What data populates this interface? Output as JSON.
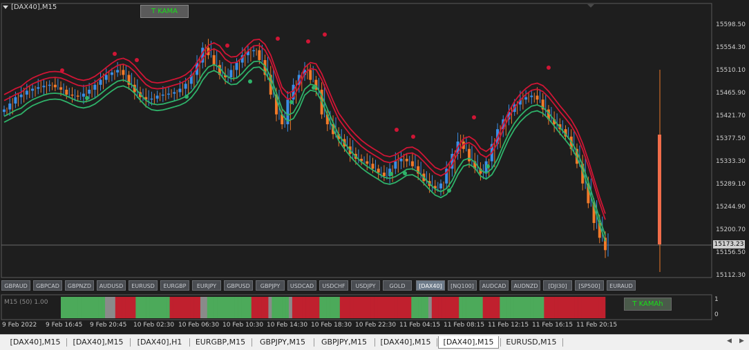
{
  "window": {
    "title": "[DAX40],M15"
  },
  "indicator_button": {
    "label": "T KAMA"
  },
  "indicator_button_2": {
    "label": "T KAMAh"
  },
  "price_axis": [
    "15598.50",
    "15554.30",
    "15510.10",
    "15465.90",
    "15421.70",
    "15377.50",
    "15333.30",
    "15289.10",
    "15244.90",
    "15200.70",
    "15156.50",
    "15112.30"
  ],
  "current_price": "15173.23",
  "subwindow": {
    "label": "M15 (50) 1.00",
    "axis": [
      "1",
      "1",
      "0",
      "0"
    ]
  },
  "symbols": [
    "GBPAUD",
    "GBPCAD",
    "GBPNZD",
    "AUDUSD",
    "EURUSD",
    "EURGBP",
    "EURJPY",
    "GBPUSD",
    "GBPJPY",
    "USDCAD",
    "USDCHF",
    "USDJPY",
    "GOLD",
    "[DAX40]",
    "[NQ100]",
    "AUDCAD",
    "AUDNZD",
    "[DJI30]",
    "[SP500]",
    "EURAUD"
  ],
  "active_symbol": "[DAX40]",
  "time_axis": [
    "9 Feb 2022",
    "9 Feb 16:45",
    "9 Feb 20:45",
    "10 Feb 02:30",
    "10 Feb 06:30",
    "10 Feb 10:30",
    "10 Feb 14:30",
    "10 Feb 18:30",
    "10 Feb 22:30",
    "11 Feb 04:15",
    "11 Feb 08:15",
    "11 Feb 12:15",
    "11 Feb 16:15",
    "11 Feb 20:15"
  ],
  "tabs": [
    "[DAX40],M15",
    "[DAX40],M15",
    "[DAX40],H1",
    "EURGBP,M15",
    "GBPJPY,M15",
    "GBPJPY,M15",
    "[DAX40],M15",
    "[DAX40],M15",
    "EURUSD,M15"
  ],
  "active_tab": 7,
  "colors": {
    "background": "#1e1e1e",
    "bull": "#3a8ee6",
    "bear": "#f07a2a",
    "upper_band": "#d01535",
    "lower_band": "#2fb36a",
    "histogram_up": "#4caa5a",
    "histogram_down": "#c0202e",
    "histogram_neutral": "#8a8a8a"
  },
  "chart_data": {
    "type": "candlestick",
    "symbol": "[DAX40]",
    "timeframe": "M15",
    "ylim": [
      15112.3,
      15620
    ],
    "close_series": [
      15450,
      15462,
      15475,
      15480,
      15488,
      15492,
      15495,
      15498,
      15500,
      15495,
      15490,
      15480,
      15478,
      15476,
      15482,
      15490,
      15500,
      15510,
      15520,
      15525,
      15530,
      15520,
      15500,
      15485,
      15475,
      15470,
      15472,
      15478,
      15480,
      15482,
      15485,
      15492,
      15502,
      15520,
      15545,
      15575,
      15560,
      15540,
      15520,
      15515,
      15530,
      15545,
      15560,
      15568,
      15570,
      15550,
      15520,
      15480,
      15440,
      15420,
      15470,
      15500,
      15520,
      15530,
      15510,
      15490,
      15440,
      15420,
      15400,
      15390,
      15375,
      15360,
      15350,
      15345,
      15340,
      15330,
      15322,
      15315,
      15330,
      15345,
      15350,
      15345,
      15335,
      15320,
      15305,
      15295,
      15290,
      15300,
      15330,
      15360,
      15385,
      15370,
      15345,
      15330,
      15320,
      15345,
      15380,
      15410,
      15430,
      15445,
      15460,
      15470,
      15475,
      15478,
      15470,
      15450,
      15430,
      15420,
      15410,
      15395,
      15370,
      15340,
      15300,
      15260,
      15220,
      15190,
      15165
    ]
  }
}
